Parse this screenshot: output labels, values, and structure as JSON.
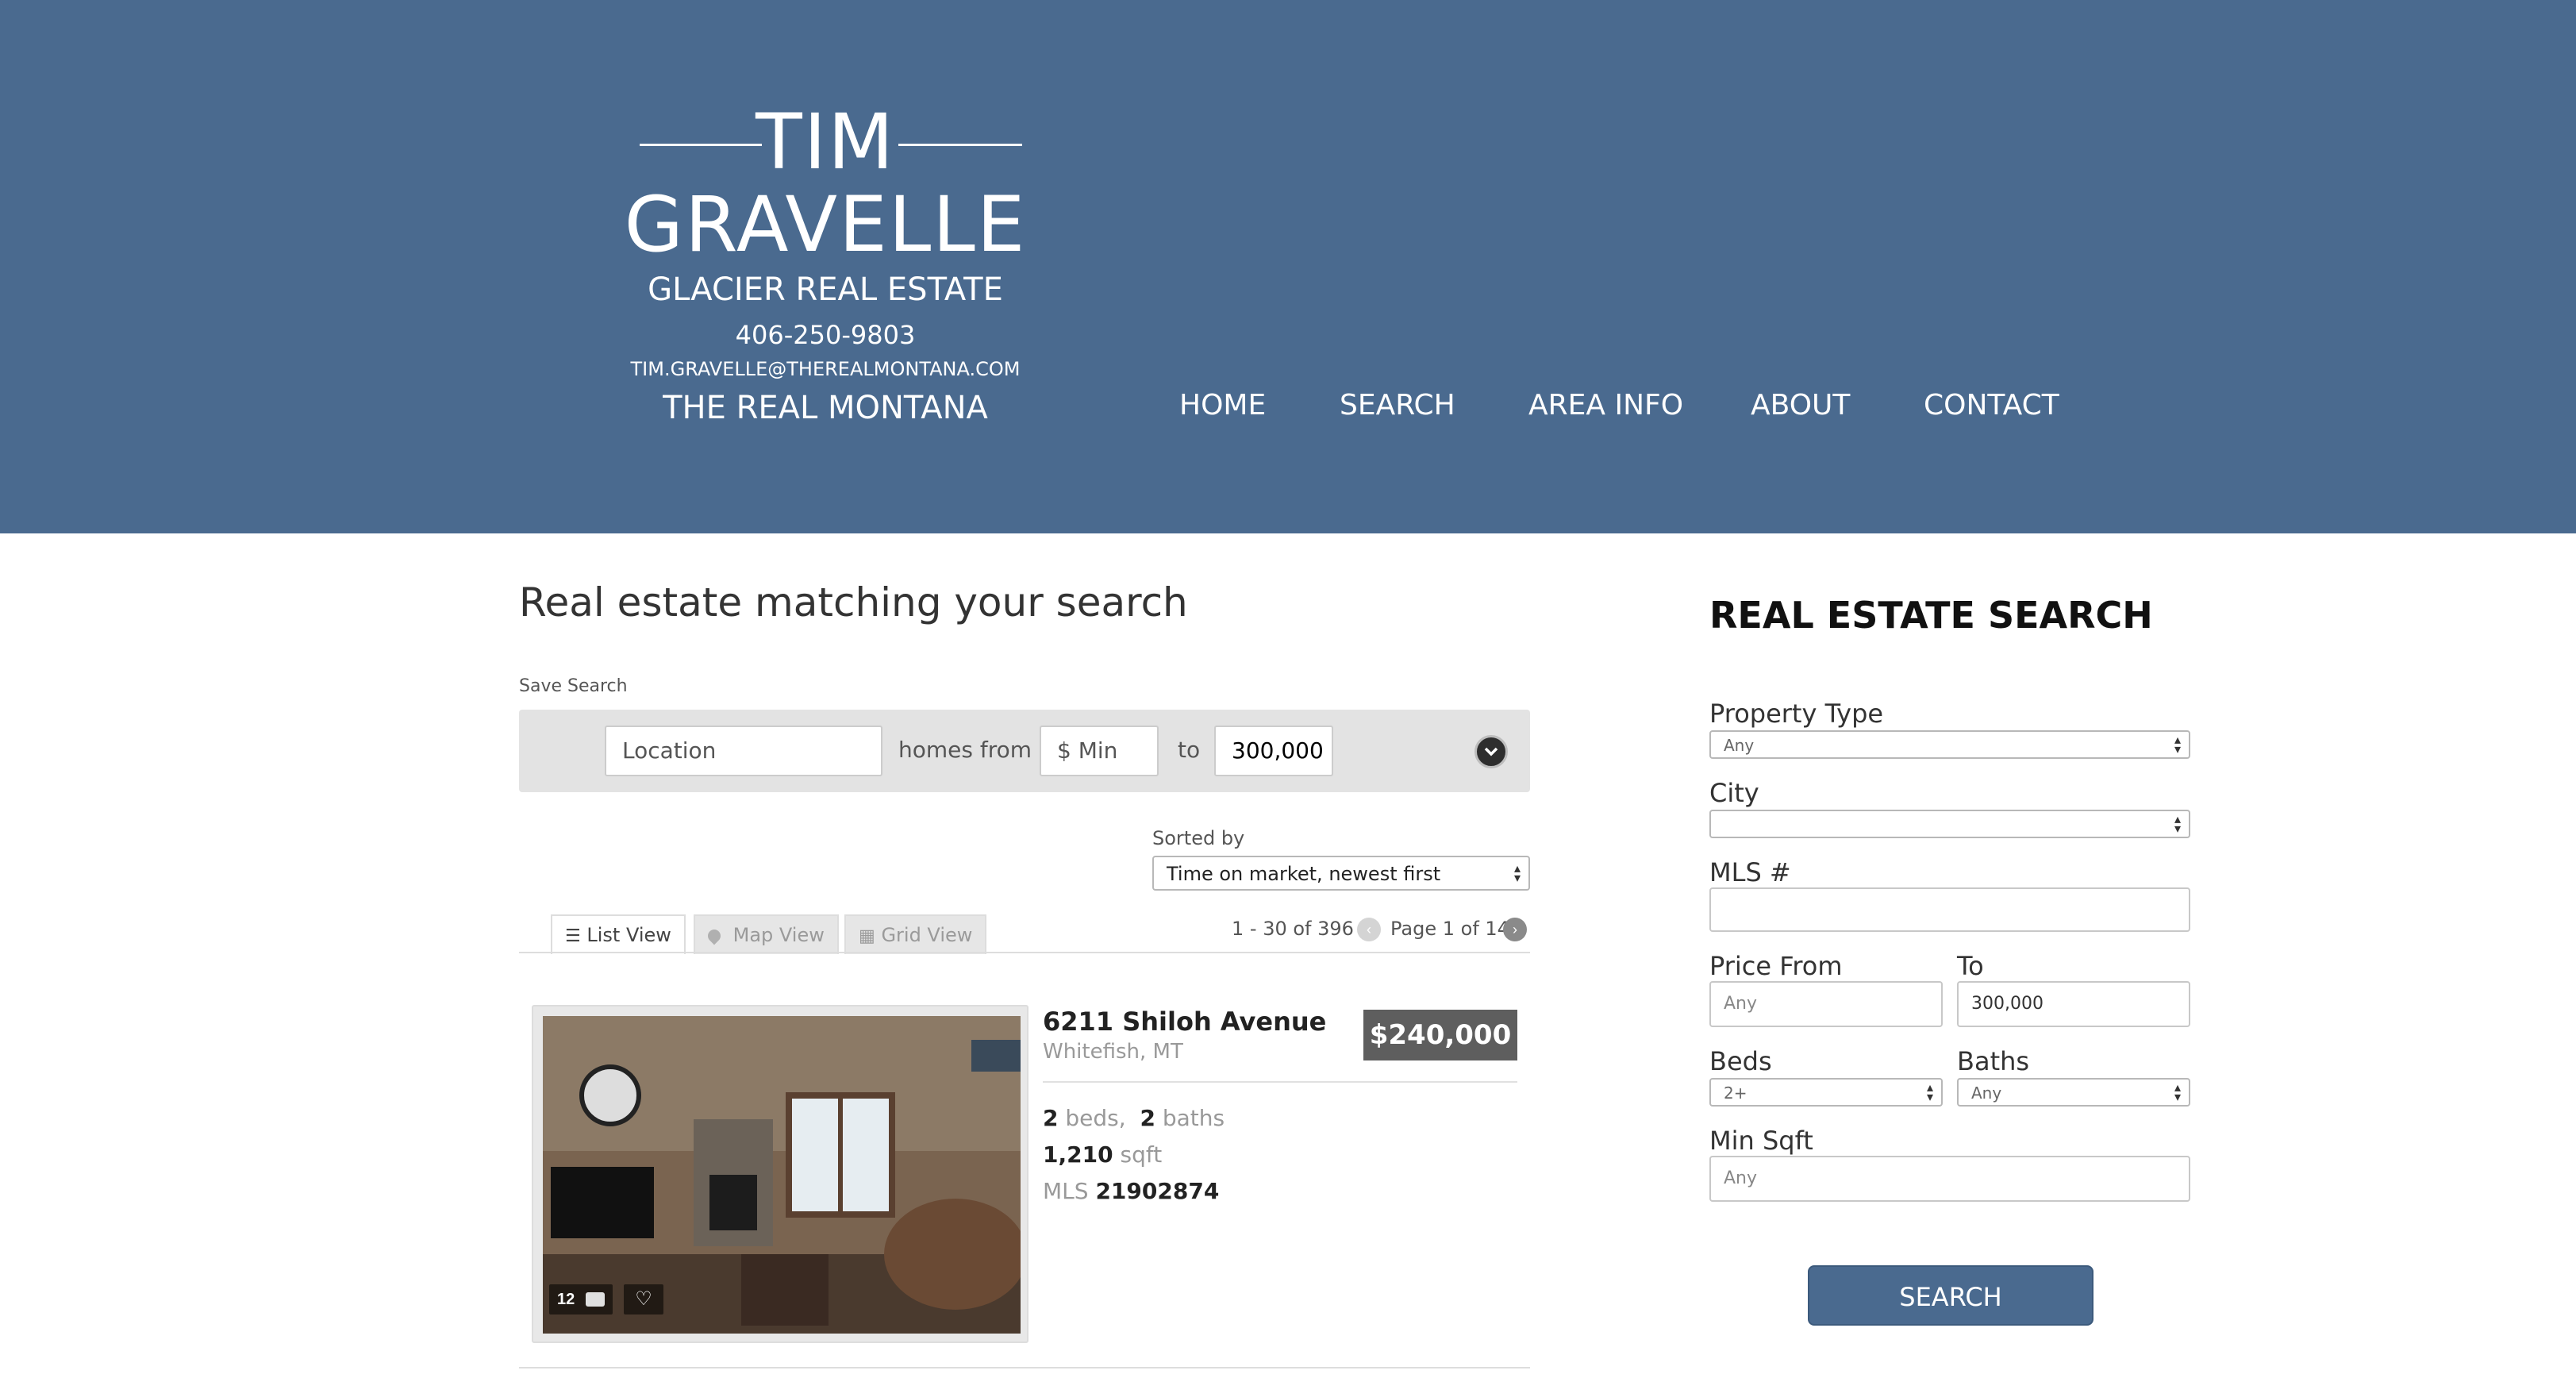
{
  "brand": {
    "name_line1": "TIM",
    "name_line2": "GRAVELLE",
    "company": "GLACIER REAL ESTATE",
    "phone": "406-250-9803",
    "email": "TIM.GRAVELLE@THEREALMONTANA.COM",
    "tagline": "THE REAL MONTANA"
  },
  "nav": {
    "items": [
      {
        "label": "HOME"
      },
      {
        "label": "SEARCH"
      },
      {
        "label": "AREA INFO"
      },
      {
        "label": "ABOUT"
      },
      {
        "label": "CONTACT"
      }
    ]
  },
  "results": {
    "heading": "Real estate matching your search",
    "save_search": "Save Search",
    "search_bar": {
      "location_placeholder": "Location",
      "homes_from": "homes from",
      "min_placeholder": "$ Min",
      "to": "to",
      "max_value": "300,000",
      "expand_icon": "chevron-down-icon"
    },
    "sort": {
      "label": "Sorted by",
      "selected": "Time on market, newest first"
    },
    "views": [
      {
        "label": "List View",
        "icon": "list-icon",
        "active": true
      },
      {
        "label": "Map View",
        "icon": "map-pin-icon",
        "active": false
      },
      {
        "label": "Grid View",
        "icon": "grid-icon",
        "active": false
      }
    ],
    "pagination": {
      "range": "1 - 30 of 396 |",
      "page": "Page 1 of 14"
    },
    "listing": {
      "address": "6211 Shiloh Avenue",
      "city": "Whitefish, MT",
      "price": "$240,000",
      "beds_value": "2",
      "beds_unit": "beds,",
      "baths_value": "2",
      "baths_unit": "baths",
      "sqft_value": "1,210",
      "sqft_unit": "sqft",
      "mls_label": "MLS",
      "mls_value": "21902874",
      "photo_count": "12"
    }
  },
  "sidebar": {
    "title": "REAL ESTATE SEARCH",
    "property_type": {
      "label": "Property Type",
      "value": "Any"
    },
    "city": {
      "label": "City",
      "value": ""
    },
    "mls": {
      "label": "MLS #",
      "value": ""
    },
    "price_from": {
      "label": "Price From",
      "placeholder": "Any"
    },
    "price_to": {
      "label": "To",
      "value": "300,000"
    },
    "beds": {
      "label": "Beds",
      "value": "2+"
    },
    "baths": {
      "label": "Baths",
      "value": "Any"
    },
    "min_sqft": {
      "label": "Min Sqft",
      "placeholder": "Any"
    },
    "search_button": "SEARCH"
  },
  "colors": {
    "header_bg": "#4a6a8f",
    "price_badge": "#5e5e5e",
    "search_button": "#4a6a8f"
  }
}
